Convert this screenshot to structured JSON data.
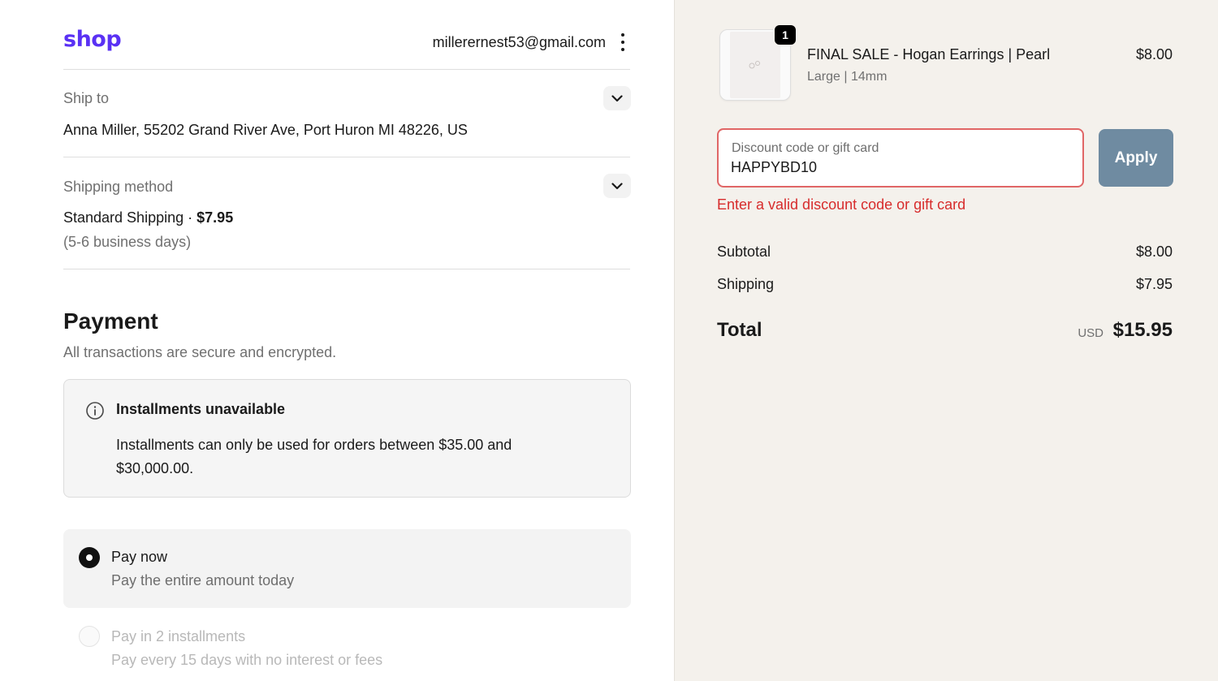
{
  "header": {
    "logo": "shop",
    "email": "millerernest53@gmail.com",
    "menu_icon": "kebab-menu-icon"
  },
  "ship_to": {
    "label": "Ship to",
    "address": "Anna Miller, 55202 Grand River Ave, Port Huron MI 48226, US"
  },
  "shipping_method": {
    "label": "Shipping method",
    "name": "Standard Shipping",
    "separator": "·",
    "price": "$7.95",
    "eta": "(5-6 business days)"
  },
  "payment": {
    "title": "Payment",
    "subtitle": "All transactions are secure and encrypted.",
    "notice": {
      "title": "Installments unavailable",
      "body": "Installments can only be used for orders between $35.00 and $30,000.00."
    },
    "options": [
      {
        "title": "Pay now",
        "subtitle": "Pay the entire amount today",
        "selected": true
      },
      {
        "title": "Pay in 2 installments",
        "subtitle": "Pay every 15 days with no interest or fees",
        "selected": false
      }
    ]
  },
  "order": {
    "item": {
      "quantity": "1",
      "name": "FINAL SALE - Hogan Earrings | Pearl",
      "variant": "Large | 14mm",
      "price": "$8.00"
    },
    "discount": {
      "placeholder": "Discount code or gift card",
      "value": "HAPPYBD10",
      "apply_label": "Apply",
      "error": "Enter a valid discount code or gift card"
    },
    "subtotal_label": "Subtotal",
    "subtotal": "$8.00",
    "shipping_label": "Shipping",
    "shipping": "$7.95",
    "total_label": "Total",
    "currency": "USD",
    "total": "$15.95"
  },
  "colors": {
    "brand": "#5a31f4",
    "error": "#d72c2c",
    "apply_button": "#6f8ba1",
    "summary_bg": "#f4f1ec"
  }
}
